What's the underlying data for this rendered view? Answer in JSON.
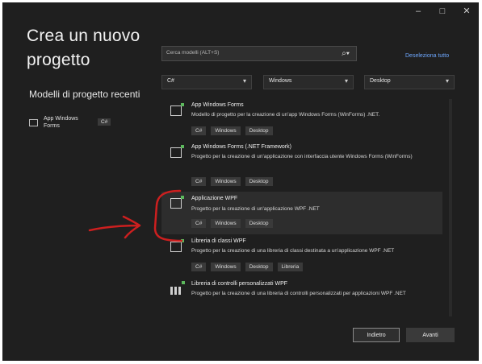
{
  "window_controls": [
    "–",
    "□",
    "✕"
  ],
  "heading": {
    "line1": "Crea un nuovo",
    "line2": "progetto"
  },
  "recent": {
    "title": "Modelli di progetto recenti",
    "items": [
      {
        "name": "App Windows Forms",
        "tag": "C#"
      }
    ]
  },
  "search": {
    "placeholder": "Cerca modelli (ALT+S)",
    "icon": "search-icon"
  },
  "clear_all": "Deseleziona tutto",
  "filters": {
    "language": "C#",
    "platform": "Windows",
    "project_type": "Desktop"
  },
  "templates": [
    {
      "name": "App Windows Forms",
      "description": "Modello di progetto per la creazione di un'app Windows Forms (WinForms) .NET.",
      "tags": [
        "C#",
        "Windows",
        "Desktop"
      ]
    },
    {
      "name": "App Windows Forms (.NET Framework)",
      "description": "Progetto per la creazione di un'applicazione con interfaccia utente Windows Forms (WinForms)",
      "tags": [
        "C#",
        "Windows",
        "Desktop"
      ]
    },
    {
      "name": "Applicazione WPF",
      "description": "Progetto per la creazione di un'applicazione WPF .NET",
      "tags": [
        "C#",
        "Windows",
        "Desktop"
      ]
    },
    {
      "name": "Libreria di classi WPF",
      "description": "Progetto per la creazione di una libreria di classi destinata a un'applicazione WPF .NET",
      "tags": [
        "C#",
        "Windows",
        "Desktop",
        "Libreria"
      ]
    },
    {
      "name": "Libreria di controlli personalizzati WPF",
      "description": "Progetto per la creazione di una libreria di controlli personalizzati per applicazioni WPF .NET",
      "tags": []
    }
  ],
  "buttons": {
    "back": "Indietro",
    "next": "Avanti"
  },
  "annotation_color": "#cc1f1f"
}
